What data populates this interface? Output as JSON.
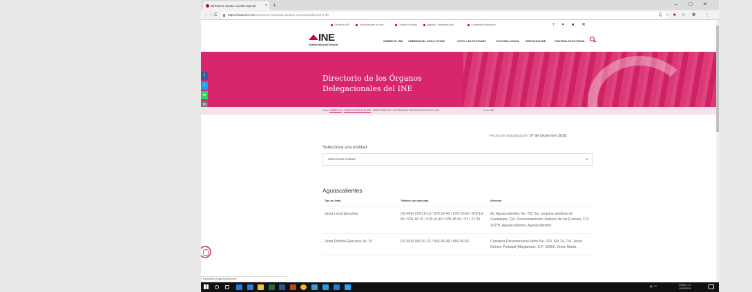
{
  "browser": {
    "tab_title": "Directorio Juntas Locales Ejecuti",
    "tab_close": "×",
    "new_tab": "+",
    "url_host": "https://www.ine.mx",
    "url_path": "/estructura-ine/juntas-locales-ejecutivas/directorio-jle/",
    "nav_back": "←",
    "nav_forward": "→",
    "nav_reload": "C",
    "window_min": "–",
    "window_max": "▢",
    "window_close": "✕",
    "ext_icons": [
      "Q",
      "☆",
      "■",
      "⊕",
      "❷",
      "⋮"
    ]
  },
  "util_bar": {
    "items": [
      {
        "label": "Directorio INE",
        "icon": "phone-icon"
      },
      {
        "label": "Transmisiones en vivo",
        "icon": "broadcast-icon"
      },
      {
        "label": "Gaceta Electoral",
        "icon": "gazette-icon"
      },
      {
        "label": "Agenda Consejeras (es)",
        "icon": "calendar-icon"
      },
      {
        "label": "Compendio Normativo",
        "icon": "book-icon"
      }
    ],
    "social": "f  ♥  ■  ⌘"
  },
  "site": {
    "logo_text": "INE",
    "logo_subtitle": "Instituto Nacional Electoral",
    "menu": [
      "SOBRE EL INE",
      "CREDENCIAL PARA VOTAR",
      "VOTO Y ELECCIONES",
      "CULTURA CÍVICA",
      "SERVICIOS INE",
      "CENTRAL ELECTORAL"
    ],
    "brand_color": "#c8005a"
  },
  "hero": {
    "title_line1": "Directorio de los Órganos",
    "title_line2": "Delegacionales del INE"
  },
  "breadcrumb": {
    "prefix": "Tema:",
    "link1": "SOBRE INE",
    "link2": "CÓMO FUNCIONA EL INE",
    "current": "DIRECTORIO DE LOS ÓRGANOS DELEGACIONALES DEL INE",
    "location": "9 mas INE"
  },
  "share": [
    "f",
    "t",
    "w",
    "✉"
  ],
  "content": {
    "update_label": "Fecha de actualización:",
    "update_date": "07 de Diciembre 2018.",
    "select_label": "Selecciona una entidad:",
    "select_value": "seleccionar entidad",
    "section_title": "Aguascalientes",
    "table": {
      "headers": [
        "Tipo de Junta",
        "Teléfono con clave lada",
        "Dirección"
      ],
      "rows": [
        {
          "tipo": "Junta Local Ejecutiva",
          "telefono": "(01-449) 978-19-19 / 978-18-40 / 978-19-56 / 978-19-86 / 978-18-70 / 978-19-40 / 978-38-65 / 917-27-81",
          "direccion": "Av. Aguascalientes No. 702 Sur, esquina Jardines de Guadalupe, Col. Fraccionamiento Jardines de las Fuentes, C.P. 20278, Aguascalientes, Aguascalientes."
        },
        {
          "tipo": "Junta Distrital Ejecutiva No. 01",
          "telefono": "(01-449) 965-01-21 / 965-06-99 / 965-06-50",
          "direccion": "Carretera Panamericana Norte No. 023, KM 14, Col. Jesús Gómez Portugal (Margaritas), C.P. 20909, Jesús María,"
        }
      ]
    }
  },
  "status_bar": "Esperando a tags.bluekai.com...",
  "taskbar": {
    "clock_time": "05:58 p. m.",
    "clock_date": "10/03/2019",
    "tray": "⁂ ^ ⊡"
  }
}
